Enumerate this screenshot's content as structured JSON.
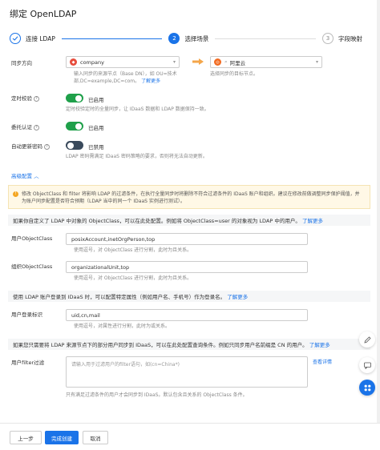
{
  "header": {
    "title": "绑定 OpenLDAP"
  },
  "steps": [
    {
      "number": "1",
      "label": "连接 LDAP",
      "state": "done"
    },
    {
      "number": "2",
      "label": "选择场景",
      "state": "active"
    },
    {
      "number": "3",
      "label": "字段映射",
      "state": "todo"
    }
  ],
  "sync_direction": {
    "label": "同步方向",
    "source_value": "company",
    "source_hint": "输入同步的来源节点（Base DN），如 OU=技术部,DC=example,DC=com。",
    "source_hint_link": "了解更多",
    "target_value": "阿里云",
    "target_hint": "选择同步的目标节点。"
  },
  "scheduled_sync": {
    "label": "定时校验",
    "state": "已启用",
    "hint": "定时校验定时的全量同步，让 IDaaS 数据和 LDAP 数据保持一致。"
  },
  "delegated_auth": {
    "label": "委托认证",
    "state": "已启用"
  },
  "auto_password": {
    "label": "自动更新密码",
    "state": "已禁用",
    "hint": "LDAP 密码需满足 IDaaS 密码策略的要求，否则将无法自动更新。"
  },
  "advanced": {
    "label": "高级配置"
  },
  "warning": {
    "text": "修改 ObjectClass 和 filter 将影响 LDAP 的过滤条件，在执行全量同步时将删除不符合过滤条件的 IDaaS 账户和组织。建议在修改前做调整同步保护阈值，并为账户同步配置是否符合预期（LDAP 当中的同一个 IDaaS 实例进行测试）。"
  },
  "custom_objectclass": {
    "bar_text": "如果你自定义了 LDAP 中对象的 ObjectClass，可以在此处配置。例如将 ObjectClass=user 的对象视为 LDAP 中的用户。",
    "bar_link": "了解更多",
    "user_label": "用户ObjectClass",
    "user_value": "posixAccount,inetOrgPerson,top",
    "user_hint": "使用逗号，对 ObjectClass 进行分割，此时为且关系。",
    "org_label": "组织ObjectClass",
    "org_value": "organizationalUnit,top",
    "org_hint": "使用逗号，对 ObjectClass 进行分割，此时为且关系。"
  },
  "login_id": {
    "bar_text": "使用 LDAP 账户登录到 IDaaS 时，可以配置特定属性（例如用户名、手机号）作为登录名。",
    "bar_link": "了解更多",
    "label": "用户登录标识",
    "value": "uid,cn,mail",
    "hint": "使用逗号，对属性进行分割，此时为或关系。"
  },
  "user_filter": {
    "bar_text": "如果您只需要将 LDAP 来源节点下的部分用户同步到 IDaaS，可以在此处配置查询条件。例如只同步用户名前缀是 CN 的用户。",
    "bar_link": "了解更多",
    "label": "用户filter过滤",
    "placeholder": "请输入用于过滤用户的filter语句，如(cn=China*)",
    "view_link": "查看详情",
    "hint": "只有满足过滤条件的用户才会同步到 IDaaS。默认包含且关系的 ObjectClass 条件。"
  },
  "footer": {
    "prev_label": "上一步",
    "confirm_label": "完成创建",
    "cancel_label": "取消"
  },
  "colors": {
    "primary": "#1a73e8",
    "success": "#1fa04a",
    "warning_bg": "#fff8e6"
  }
}
